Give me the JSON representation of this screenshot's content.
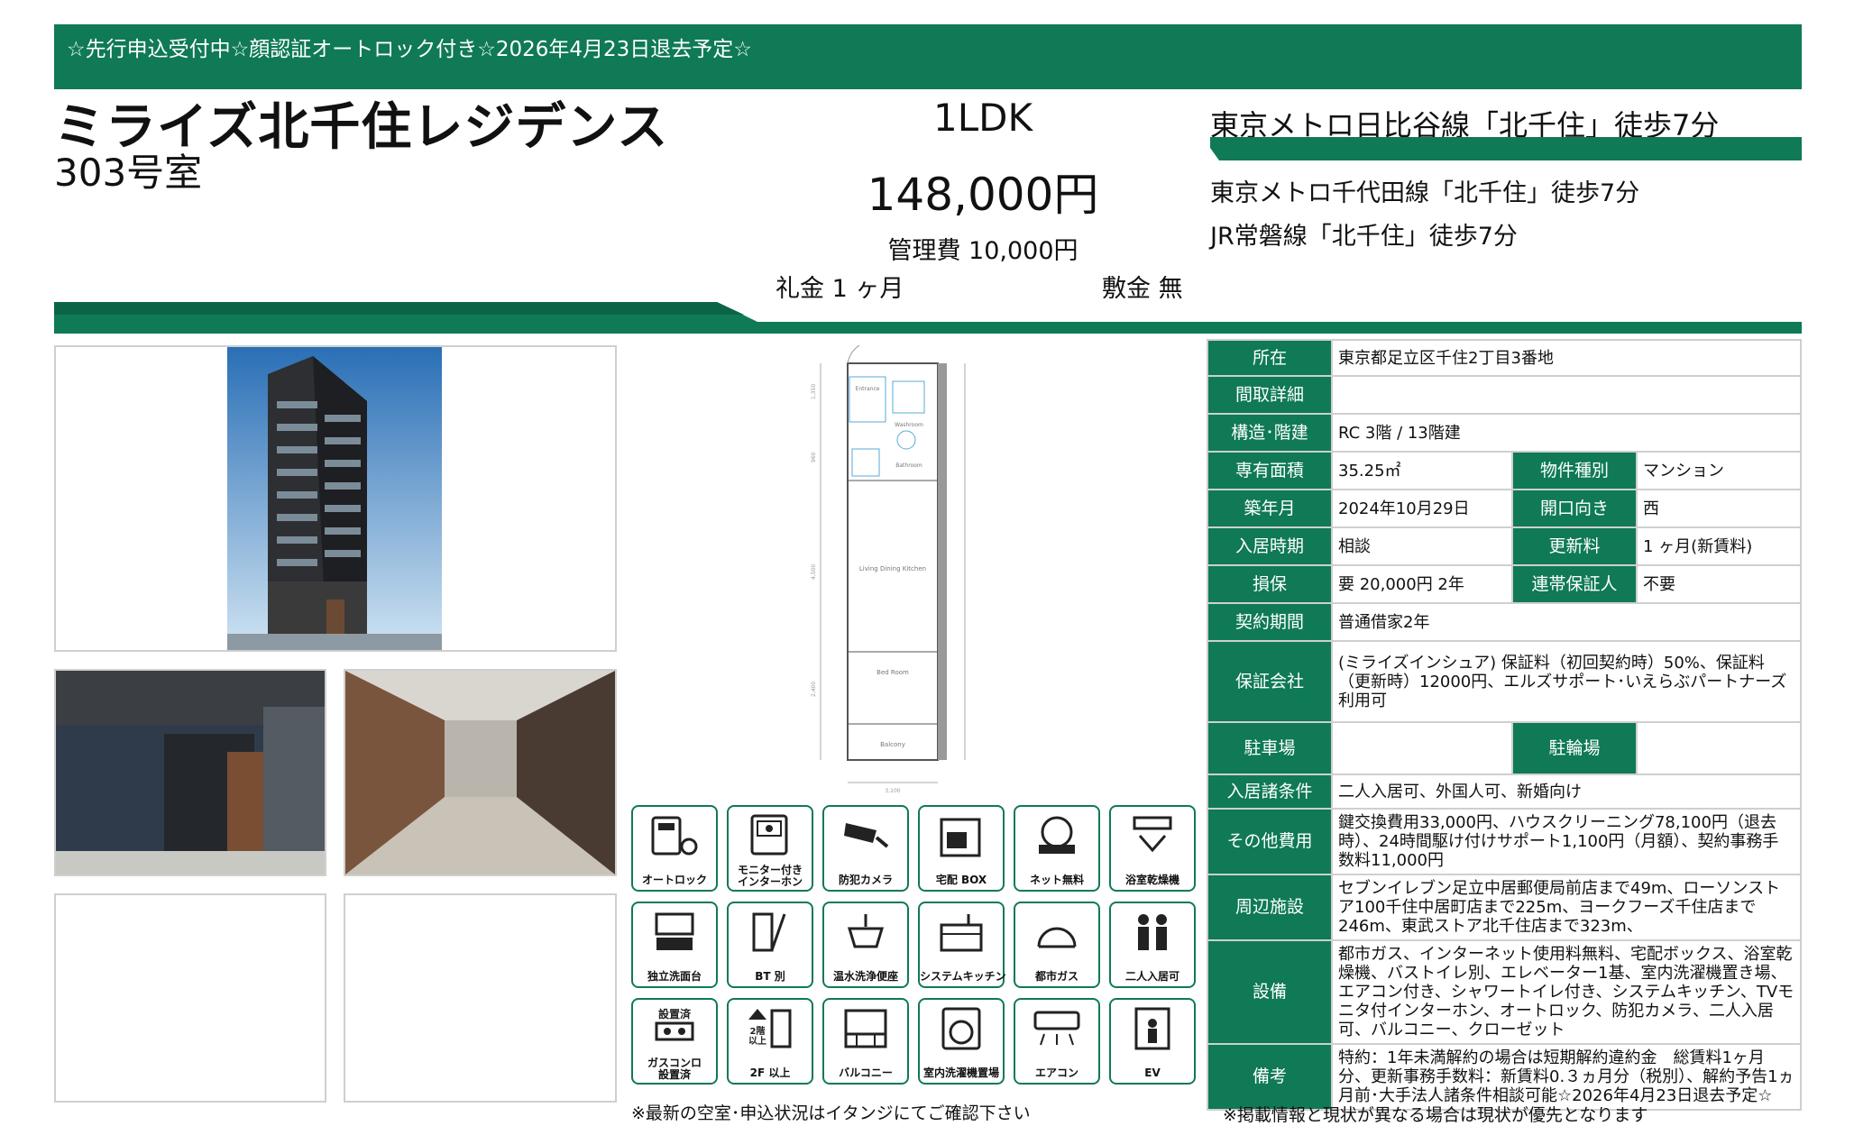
{
  "banner": "☆先行申込受付中☆顔認証オートロック付き☆2026年4月23日退去予定☆",
  "building_name": "ミライズ北千住レジデンス",
  "room": "303号室",
  "layout_type": "1LDK",
  "rent": "148,000円",
  "management_fee": "管理費 10,000円",
  "key_money": "礼金 1 ヶ月",
  "deposit": "敷金 無",
  "stations": [
    "東京メトロ日比谷線「北千住」徒歩7分",
    "東京メトロ千代田線「北千住」徒歩7分",
    "JR常磐線「北千住」徒歩7分"
  ],
  "amenities": [
    {
      "label": "オートロック",
      "icon": "autolock-icon"
    },
    {
      "label": "モニター付き\nインターホン",
      "icon": "intercom-icon"
    },
    {
      "label": "防犯カメラ",
      "icon": "camera-icon"
    },
    {
      "label": "宅配 BOX",
      "icon": "delivery-box-icon"
    },
    {
      "label": "ネット無料",
      "icon": "internet-icon"
    },
    {
      "label": "浴室乾燥機",
      "icon": "bath-dryer-icon"
    },
    {
      "label": "独立洗面台",
      "icon": "vanity-icon"
    },
    {
      "label": "BT 別",
      "icon": "bath-toilet-separate-icon"
    },
    {
      "label": "温水洗浄便座",
      "icon": "washlet-icon"
    },
    {
      "label": "システムキッチン",
      "icon": "kitchen-icon"
    },
    {
      "label": "都市ガス",
      "icon": "city-gas-icon"
    },
    {
      "label": "二人入居可",
      "icon": "two-person-icon"
    },
    {
      "label": "ガスコンロ\n設置済",
      "icon": "gas-stove-icon"
    },
    {
      "label": "2F 以上",
      "icon": "second-floor-icon"
    },
    {
      "label": "バルコニー",
      "icon": "balcony-icon"
    },
    {
      "label": "室内洗濯機置場",
      "icon": "washer-icon"
    },
    {
      "label": "エアコン",
      "icon": "aircon-icon"
    },
    {
      "label": "EV",
      "icon": "elevator-icon"
    }
  ],
  "icon_extra": {
    "gas_top": "設置済",
    "floor_text": "2階\n以上"
  },
  "spec": {
    "location_label": "所在",
    "location": "東京都足立区千住2丁目3番地",
    "layout_detail_label": "間取詳細",
    "layout_detail": "",
    "structure_label": "構造･階建",
    "structure": "RC 3階 / 13階建",
    "area_label": "専有面積",
    "area": "35.25㎡",
    "type_label": "物件種別",
    "type": "マンション",
    "built_label": "築年月",
    "built": "2024年10月29日",
    "direction_label": "開口向き",
    "direction": "西",
    "move_in_label": "入居時期",
    "move_in": "相談",
    "renewal_label": "更新料",
    "renewal": "1 ヶ月(新賃料)",
    "insurance_label": "損保",
    "insurance": "要 20,000円 2年",
    "guarantor_label": "連帯保証人",
    "guarantor": "不要",
    "contract_label": "契約期間",
    "contract": "普通借家2年",
    "guarantee_company_label": "保証会社",
    "guarantee_company": "(ミライズインシュア) 保証料（初回契約時）50%、保証料（更新時）12000円、エルズサポート･いえらぶパートナーズ利用可",
    "parking_label": "駐車場",
    "parking": "",
    "bike_label": "駐輪場",
    "bike": "",
    "conditions_label": "入居諸条件",
    "conditions": "二人入居可、外国人可、新婚向け",
    "other_fees_label": "その他費用",
    "other_fees": "鍵交換費用33,000円、ハウスクリーニング78,100円（退去時）、24時間駆け付けサポート1,100円（月額）、契約事務手数料11,000円",
    "nearby_label": "周辺施設",
    "nearby": "セブンイレブン足立中居郵便局前店まで49m、ローソンストア100千住中居町店まで225m、ヨークフーズ千住店まで246m、東武ストア北千住店まで323m、",
    "facilities_label": "設備",
    "facilities": "都市ガス、インターネット使用料無料、宅配ボックス、浴室乾燥機、バストイレ別、エレベーター1基、室内洗濯機置き場、エアコン付き、シャワートイレ付き、システムキッチン、TVモニタ付インターホン、オートロック、防犯カメラ、二人入居可、バルコニー、クローゼット",
    "remarks_label": "備考",
    "remarks": "特約：1年未満解約の場合は短期解約違約金　総賃料1ヶ月分、更新事務手数料：新賃料0.３ヵ月分（税別）、解約予告1ヵ月前･大手法人諸条件相談可能☆2026年4月23日退去予定☆"
  },
  "floorplan_labels": {
    "living": "Living Dining Kitchen",
    "bedroom": "Bed Room",
    "balcony": "Balcony",
    "entrance": "Entrance",
    "washroom": "Washroom",
    "bathroom": "Bathroom",
    "dims": [
      "1,350",
      "960",
      "4,500",
      "2,400",
      "3,100"
    ]
  },
  "note_left": "※最新の空室･申込状況はイタンジにてご確認下さい",
  "note_right": "※掲載情報と現状が異なる場合は現状が優先となります",
  "colors": {
    "brand_green": "#0f7a55"
  }
}
